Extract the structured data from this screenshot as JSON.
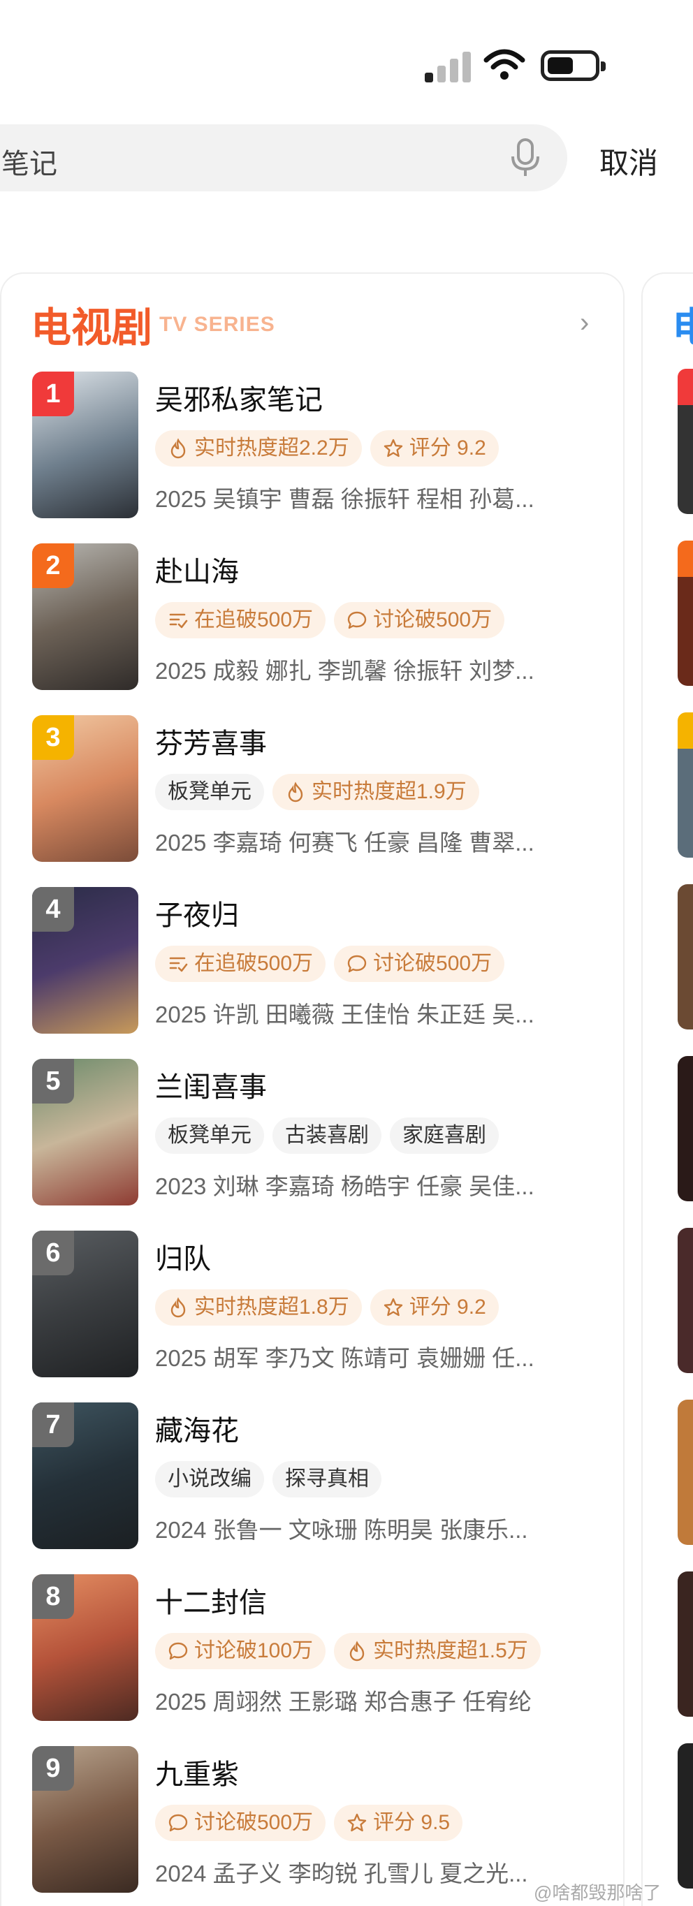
{
  "search": {
    "text": "笔记",
    "cancel": "取消"
  },
  "section": {
    "title": "电视剧",
    "subtitle": "TV SERIES",
    "side_title": "电"
  },
  "colors": {
    "rank1": "#f03a3a",
    "rank2": "#f46a1c",
    "rank3": "#f5b300",
    "rank_other": "#6b6b6b",
    "accent": "#f25b2a"
  },
  "items": [
    {
      "rank": "1",
      "title": "吴邪私家笔记",
      "tags": [
        {
          "icon": "flame-icon",
          "text": "实时热度超2.2万",
          "style": "hot"
        },
        {
          "icon": "star-icon",
          "text": "评分 9.2",
          "style": "hot"
        }
      ],
      "meta": "2025 吴镇宇 曹磊 徐振轩 程相 孙葛..."
    },
    {
      "rank": "2",
      "title": "赴山海",
      "tags": [
        {
          "icon": "list-check-icon",
          "text": "在追破500万",
          "style": "hot"
        },
        {
          "icon": "comment-icon",
          "text": "讨论破500万",
          "style": "hot"
        }
      ],
      "meta": "2025 成毅 娜扎 李凯馨 徐振轩 刘梦..."
    },
    {
      "rank": "3",
      "title": "芬芳喜事",
      "tags": [
        {
          "icon": "",
          "text": "板凳单元",
          "style": "plain"
        },
        {
          "icon": "flame-icon",
          "text": "实时热度超1.9万",
          "style": "hot"
        }
      ],
      "meta": "2025 李嘉琦 何赛飞 任豪 昌隆 曹翠..."
    },
    {
      "rank": "4",
      "title": "子夜归",
      "tags": [
        {
          "icon": "list-check-icon",
          "text": "在追破500万",
          "style": "hot"
        },
        {
          "icon": "comment-icon",
          "text": "讨论破500万",
          "style": "hot"
        }
      ],
      "meta": "2025 许凯 田曦薇 王佳怡 朱正廷 吴..."
    },
    {
      "rank": "5",
      "title": "兰闺喜事",
      "tags": [
        {
          "icon": "",
          "text": "板凳单元",
          "style": "plain"
        },
        {
          "icon": "",
          "text": "古装喜剧",
          "style": "plain"
        },
        {
          "icon": "",
          "text": "家庭喜剧",
          "style": "plain"
        }
      ],
      "meta": "2023 刘琳 李嘉琦 杨皓宇 任豪 吴佳..."
    },
    {
      "rank": "6",
      "title": "归队",
      "tags": [
        {
          "icon": "flame-icon",
          "text": "实时热度超1.8万",
          "style": "hot"
        },
        {
          "icon": "star-icon",
          "text": "评分 9.2",
          "style": "hot"
        }
      ],
      "meta": "2025 胡军 李乃文 陈靖可 袁姗姗 任..."
    },
    {
      "rank": "7",
      "title": "藏海花",
      "tags": [
        {
          "icon": "",
          "text": "小说改编",
          "style": "plain"
        },
        {
          "icon": "",
          "text": "探寻真相",
          "style": "plain"
        }
      ],
      "meta": "2024 张鲁一 文咏珊 陈明昊 张康乐..."
    },
    {
      "rank": "8",
      "title": "十二封信",
      "tags": [
        {
          "icon": "comment-icon",
          "text": "讨论破100万",
          "style": "hot"
        },
        {
          "icon": "flame-icon",
          "text": "实时热度超1.5万",
          "style": "hot"
        }
      ],
      "meta": "2025 周翊然 王影璐 郑合惠子 任宥纶"
    },
    {
      "rank": "9",
      "title": "九重紫",
      "tags": [
        {
          "icon": "comment-icon",
          "text": "讨论破500万",
          "style": "hot"
        },
        {
          "icon": "star-icon",
          "text": "评分 9.5",
          "style": "hot"
        }
      ],
      "meta": "2024 孟子义 李昀锐 孔雪儿 夏之光..."
    }
  ],
  "watermark": "@啥都毁那啥了"
}
